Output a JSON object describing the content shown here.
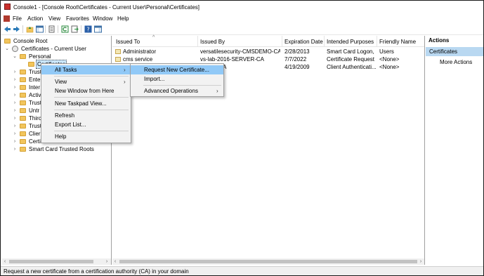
{
  "window": {
    "title": "Console1 - [Console Root\\Certificates - Current User\\Personal\\Certificates]"
  },
  "menubar": {
    "items": [
      "File",
      "Action",
      "View",
      "Favorites",
      "Window",
      "Help"
    ]
  },
  "toolbar": {
    "icons": [
      "back-arrow-icon",
      "forward-arrow-icon",
      "up-folder-icon",
      "show-hide-tree-icon",
      "properties-icon",
      "refresh-icon",
      "export-list-icon",
      "help-icon",
      "show-hide-action-pane-icon"
    ]
  },
  "tree": {
    "root": "Console Root",
    "certs_user": "Certificates - Current User",
    "personal": "Personal",
    "certificates": "Certificates",
    "partial": [
      "Trust",
      "Ente",
      "Inter",
      "Activ",
      "Trust",
      "Untr",
      "Thirc",
      "Trust",
      "Clier",
      "Certi"
    ],
    "smartcard": "Smart Card Trusted Roots"
  },
  "list": {
    "columns": [
      "Issued To",
      "Issued By",
      "Expiration Date",
      "Intended Purposes",
      "Friendly Name"
    ],
    "rows": [
      [
        "Administrator",
        "versatilesecurity-CMSDEMO-CA",
        "2/28/2013",
        "Smart Card Logon, ...",
        "Users"
      ],
      [
        "cms service",
        "vs-lab-2016-SERVER-CA",
        "7/7/2022",
        "Certificate Request ...",
        "<None>"
      ],
      [
        "",
        "",
        "4/19/2009",
        "Client Authenticati...",
        "<None>"
      ]
    ],
    "row3_partial_issued_by": "A"
  },
  "actions": {
    "header": "Actions",
    "section": "Certificates",
    "more": "More Actions"
  },
  "context_menu": {
    "all_tasks": "All Tasks",
    "view": "View",
    "new_window": "New Window from Here",
    "new_taskpad": "New Taskpad View...",
    "refresh": "Refresh",
    "export_list": "Export List...",
    "help": "Help"
  },
  "submenu": {
    "request_new": "Request New Certificate...",
    "import": "Import...",
    "advanced": "Advanced Operations"
  },
  "statusbar": {
    "text": "Request a new certificate from a certification authority (CA) in your domain"
  },
  "colors": {
    "menu_highlight": "#91c9f7",
    "actions_section": "#b9d8f1",
    "folder": "#f2c55c"
  }
}
